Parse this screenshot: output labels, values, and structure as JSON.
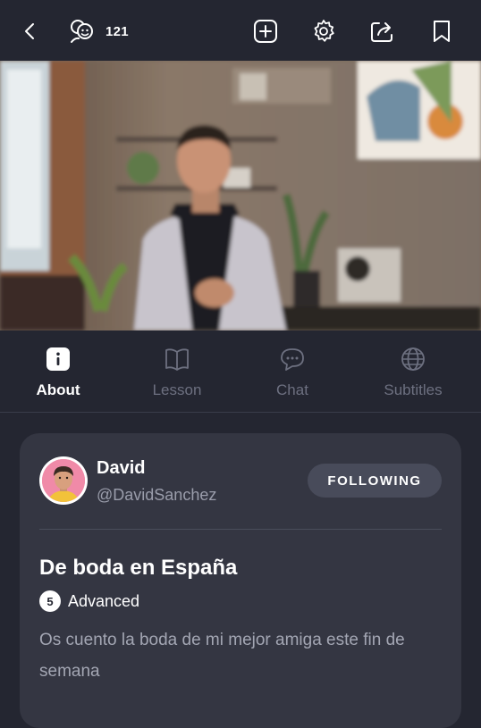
{
  "header": {
    "viewer_count": "121",
    "icons": [
      "back-arrow-icon",
      "viewers-icon",
      "add-icon",
      "gear-icon",
      "share-icon",
      "bookmark-icon"
    ]
  },
  "tabs": [
    {
      "label": "About",
      "icon": "info-icon",
      "active": true
    },
    {
      "label": "Lesson",
      "icon": "book-icon",
      "active": false
    },
    {
      "label": "Chat",
      "icon": "chat-bubble-icon",
      "active": false
    },
    {
      "label": "Subtitles",
      "icon": "globe-icon",
      "active": false
    }
  ],
  "author": {
    "name": "David",
    "handle": "@DavidSanchez",
    "follow_label": "FOLLOWING"
  },
  "lesson": {
    "title": "De boda en España",
    "level_number": "5",
    "level_label": "Advanced",
    "description": "Os cuento la boda de mi mejor amiga este fin de semana"
  },
  "colors": {
    "background": "#242631",
    "card": "#343642",
    "following_button": "#484b5a",
    "inactive_tab": "#6d7080"
  }
}
